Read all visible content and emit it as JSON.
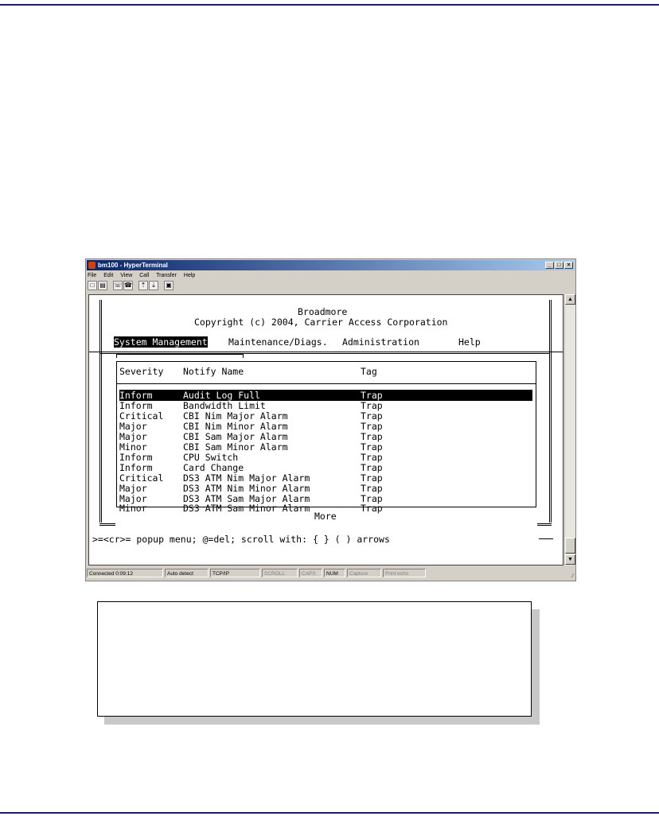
{
  "window": {
    "title": "bm100 - HyperTerminal",
    "menu": [
      "File",
      "Edit",
      "View",
      "Call",
      "Transfer",
      "Help"
    ],
    "caption_buttons": [
      "_",
      "□",
      "×"
    ]
  },
  "terminal": {
    "header_title": "Broadmore",
    "header_copyright": "Copyright (c) 2004, Carrier Access Corporation",
    "menu": {
      "system_management": "System Management",
      "maintenance": "Maintenance/Diags.",
      "administration": "Administration",
      "help": "Help"
    },
    "columns": {
      "severity": "Severity",
      "notify_name": "Notify Name",
      "tag": "Tag"
    },
    "rows": [
      {
        "severity": "Inform",
        "name": "Audit Log Full",
        "tag": "Trap"
      },
      {
        "severity": "Inform",
        "name": "Bandwidth Limit",
        "tag": "Trap"
      },
      {
        "severity": "Critical",
        "name": "CBI Nim Major Alarm",
        "tag": "Trap"
      },
      {
        "severity": "Major",
        "name": "CBI Nim Minor Alarm",
        "tag": "Trap"
      },
      {
        "severity": "Major",
        "name": "CBI Sam Major Alarm",
        "tag": "Trap"
      },
      {
        "severity": "Minor",
        "name": "CBI Sam Minor Alarm",
        "tag": "Trap"
      },
      {
        "severity": "Inform",
        "name": "CPU Switch",
        "tag": "Trap"
      },
      {
        "severity": "Inform",
        "name": "Card Change",
        "tag": "Trap"
      },
      {
        "severity": "Critical",
        "name": "DS3 ATM Nim Major Alarm",
        "tag": "Trap"
      },
      {
        "severity": "Major",
        "name": "DS3 ATM Nim Minor Alarm",
        "tag": "Trap"
      },
      {
        "severity": "Major",
        "name": "DS3 ATM Sam Major Alarm",
        "tag": "Trap"
      },
      {
        "severity": "Minor",
        "name": "DS3 ATM Sam Minor Alarm",
        "tag": "Trap"
      }
    ],
    "more_label": "More",
    "help_line": ">=<cr>= popup menu; @=del; scroll with: { } ( ) arrows"
  },
  "status_bar": {
    "connected": "Connected 0:09:12",
    "detect": "Auto detect",
    "protocol": "TCP/IP",
    "scroll": "SCROLL",
    "caps": "CAPS",
    "num": "NUM",
    "capture": "Capture",
    "print_echo": "Print echo"
  }
}
